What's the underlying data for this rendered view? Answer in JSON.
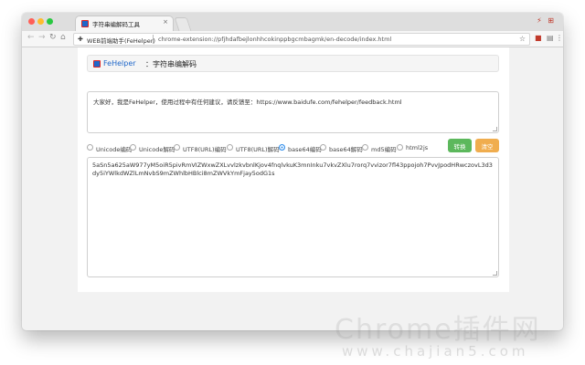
{
  "browser": {
    "tab_title": "字符串编解码工具",
    "tab_close": "×",
    "url_site": "WEB前端助手(FeHelper)",
    "url_path": "chrome-extension://pfjhdafbejlonhhcokinppbgcmbagmk/en-decode/index.html",
    "corner_icons": "⚡ ⊞"
  },
  "header": {
    "brand": "FeHelper",
    "title": "：字符串编解码"
  },
  "input": {
    "value": "大家好，我是FeHelper，使用过程中有任何建议，请反馈至：https://www.baidufe.com/fehelper/feedback.html"
  },
  "options": [
    {
      "label": "Unicode编码",
      "checked": false
    },
    {
      "label": "Unicode解码",
      "checked": false
    },
    {
      "label": "UTF8(URL)编码",
      "checked": false
    },
    {
      "label": "UTF8(URL)解码",
      "checked": false
    },
    {
      "label": "base64编码",
      "checked": true
    },
    {
      "label": "base64解码",
      "checked": false
    },
    {
      "label": "md5编码",
      "checked": false
    },
    {
      "label": "html2js",
      "checked": false
    }
  ],
  "buttons": {
    "convert": "转换",
    "clear": "清空"
  },
  "output": {
    "value": "5aSn5a625aW977yM5oiR5pivRmVIZWxwZXLvvlzkvbnlKjov4fnqlvkuK3mnInku7vkvZXlu7rorq7vvizor7fl43ppojoh7PvvJpodHRwczovL3d3dy5iYWlkdWZlLmNvbS9mZWhlbHBlci8mZWVkYmFjay5odG1s"
  },
  "watermark": {
    "line1": "Chrome插件网",
    "line2": "www.chajian5.com"
  },
  "colors": {
    "convert_button": "#5cb85c",
    "clear_button": "#f0ad4e",
    "brand": "#1e66c9",
    "radio_selected": "#2d8ceb"
  }
}
